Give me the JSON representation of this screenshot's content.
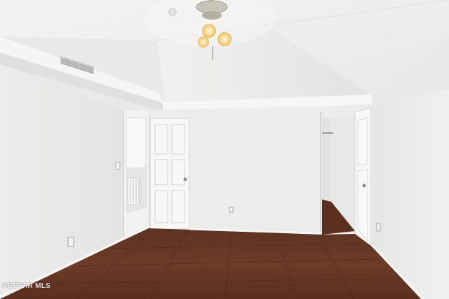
{
  "watermark": {
    "text": "©GEPAR MLS"
  },
  "colors": {
    "wall": "#ebebea",
    "wall_shade": "#dedede",
    "ceiling": "#efefee",
    "floor": "#6a3a28",
    "door": "#f7f7f6",
    "trim": "#f4f4f3"
  },
  "icons": [
    "ceiling-fan-light-icon",
    "air-vent-icon",
    "electrical-outlet-icon",
    "door-knob-icon"
  ]
}
